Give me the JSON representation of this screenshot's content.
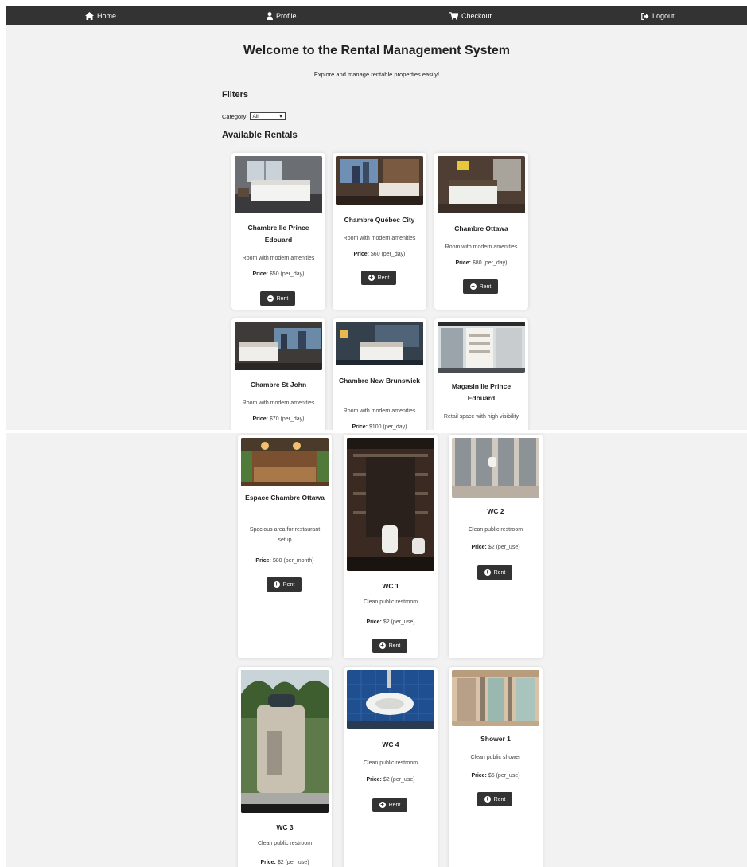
{
  "nav": {
    "home": "Home",
    "profile": "Profile",
    "checkout": "Checkout",
    "logout": "Logout"
  },
  "header": {
    "title": "Welcome to the Rental Management System",
    "subtitle": "Explore and manage rentable properties easily!"
  },
  "filters": {
    "heading": "Filters",
    "category_label": "Category:",
    "category_value": "All"
  },
  "rentals_heading": "Available Rentals",
  "rent_label": "Rent",
  "price_label": "Price:",
  "rentals": [
    {
      "title": "Chambre Ile Prince Edouard",
      "desc": "Room with modern amenities",
      "price": "$50 (per_day)"
    },
    {
      "title": "Chambre Québec City",
      "desc": "Room with modern amenities",
      "price": "$60 (per_day)"
    },
    {
      "title": "Chambre Ottawa",
      "desc": "Room with modern amenities",
      "price": "$80 (per_day)"
    },
    {
      "title": "Chambre St John",
      "desc": "Room with modern amenities",
      "price": "$70 (per_day)"
    },
    {
      "title": "Chambre New Brunswick",
      "desc": "Room with modern amenities",
      "price": "$100 (per_day)"
    },
    {
      "title": "Magasin Ile Prince Edouard",
      "desc": "Retail space with high visibility",
      "price": ""
    },
    {
      "title": "Espace Chambre Ottawa",
      "desc": "Spacious area for restaurant setup",
      "price": "$80 (per_month)"
    },
    {
      "title": "WC 1",
      "desc": "Clean public restroom",
      "price": "$2 (per_use)"
    },
    {
      "title": "WC 2",
      "desc": "Clean public restroom",
      "price": "$2 (per_use)"
    },
    {
      "title": "WC 3",
      "desc": "Clean public restroom",
      "price": "$2 (per_use)"
    },
    {
      "title": "WC 4",
      "desc": "Clean public restroom",
      "price": "$2 (per_use)"
    },
    {
      "title": "Shower 1",
      "desc": "Clean public shower",
      "price": "$5 (per_use)"
    }
  ],
  "colors": {
    "navbar": "#333333",
    "page_background": "#f2f2f2",
    "card_background": "#ffffff",
    "button": "#333333"
  }
}
